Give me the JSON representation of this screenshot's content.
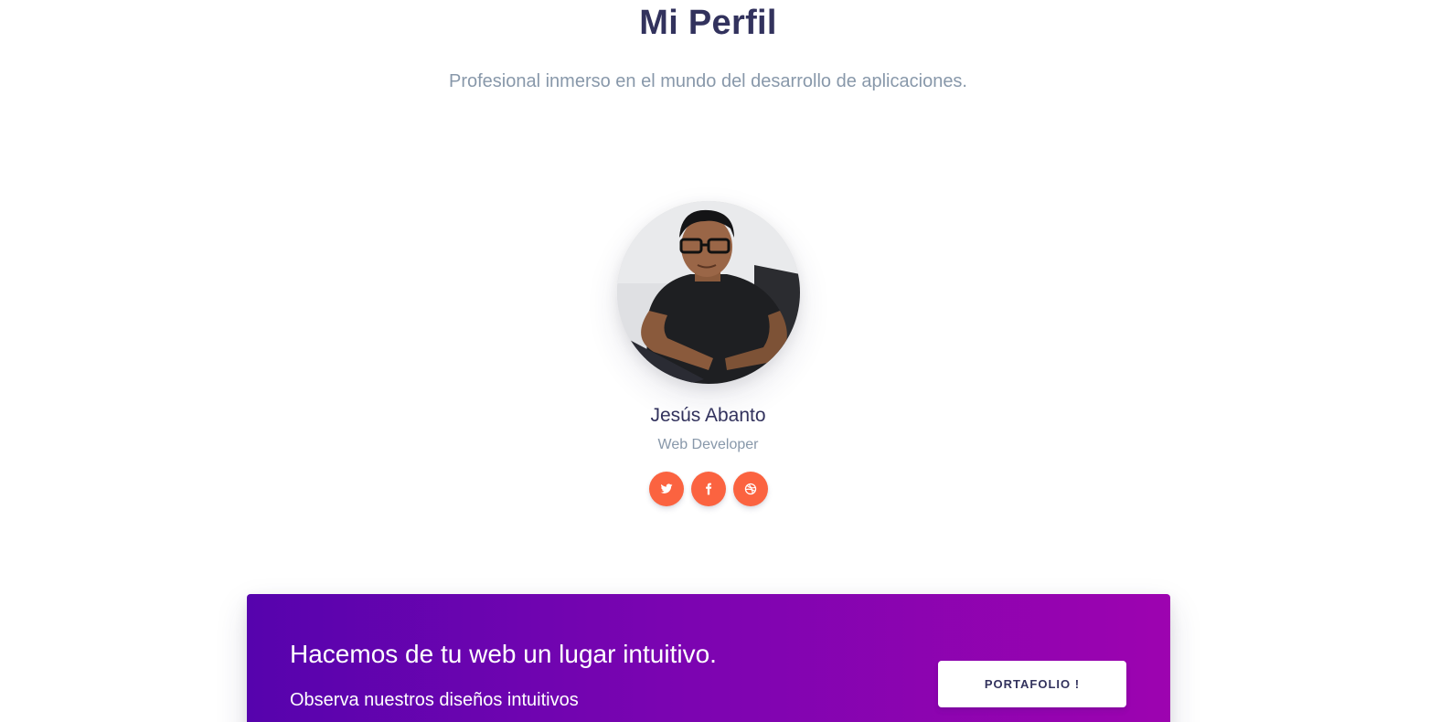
{
  "header": {
    "title": "Mi Perfil",
    "subtitle": "Profesional inmerso en el mundo del desarrollo de aplicaciones."
  },
  "profile": {
    "name": "Jesús Abanto",
    "role": "Web Developer",
    "social": [
      {
        "network": "twitter",
        "icon": "twitter-icon"
      },
      {
        "network": "facebook",
        "icon": "facebook-icon"
      },
      {
        "network": "dribbble",
        "icon": "dribbble-icon"
      }
    ]
  },
  "banner": {
    "title": "Hacemos de tu web un lugar intuitivo.",
    "subtitle": "Observa nuestros diseños intuitivos",
    "button_label": "PORTAFOLIO !"
  },
  "colors": {
    "title": "#32325d",
    "muted": "#8898aa",
    "social": "#fb6340",
    "gradient_start": "#5603ad",
    "gradient_end": "#9d03b0"
  }
}
